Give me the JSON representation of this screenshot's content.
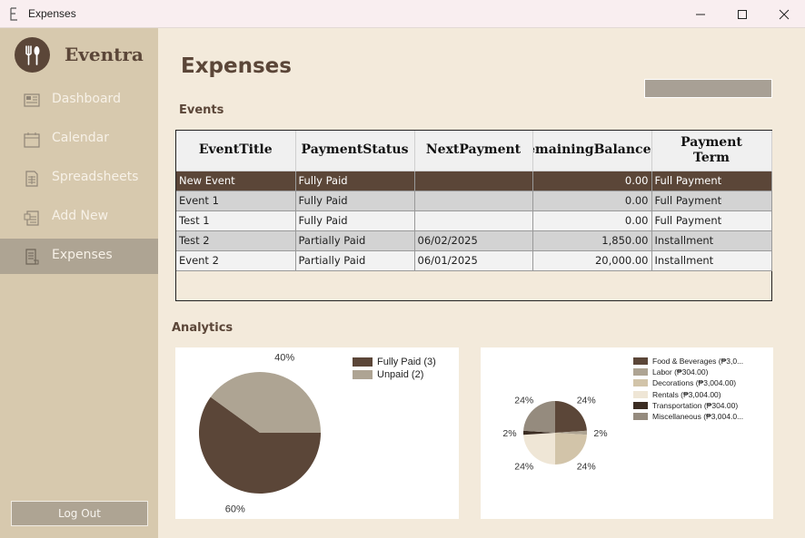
{
  "window": {
    "title": "Expenses"
  },
  "sidebar": {
    "brand": "Eventra",
    "items": [
      {
        "label": "Dashboard",
        "icon": "dashboard-icon",
        "active": false
      },
      {
        "label": "Calendar",
        "icon": "calendar-icon",
        "active": false
      },
      {
        "label": "Spreadsheets",
        "icon": "spreadsheet-icon",
        "active": false
      },
      {
        "label": "Add New",
        "icon": "add-new-icon",
        "active": false
      },
      {
        "label": "Expenses",
        "icon": "expenses-icon",
        "active": true
      }
    ],
    "logout_label": "Log Out"
  },
  "main": {
    "title": "Expenses",
    "events_label": "Events",
    "analytics_label": "Analytics",
    "table": {
      "headers": [
        "EventTitle",
        "PaymentStatus",
        "NextPayment",
        "RemainingBalance",
        "Payment\nTerm"
      ],
      "rows": [
        [
          "New Event",
          "Fully Paid",
          "",
          "0.00",
          "Full Payment"
        ],
        [
          "Event 1",
          "Fully Paid",
          "",
          "0.00",
          "Full Payment"
        ],
        [
          "Test 1",
          "Fully Paid",
          "",
          "0.00",
          "Full Payment"
        ],
        [
          "Test 2",
          "Partially Paid",
          "06/02/2025",
          "1,850.00",
          "Installment"
        ],
        [
          "Event 2",
          "Partially Paid",
          "06/01/2025",
          "20,000.00",
          "Installment"
        ]
      ]
    }
  },
  "colors": {
    "brand": "#5b4638",
    "sidebar_bg": "#d7c9ae",
    "active_bg": "#aea493",
    "page_bg": "#f3eadb"
  },
  "chart_data": [
    {
      "type": "pie",
      "series": [
        {
          "name": "Fully Paid (3)",
          "value": 60,
          "label": "60%",
          "color": "#5b4638"
        },
        {
          "name": "Unpaid (2)",
          "value": 40,
          "label": "40%",
          "color": "#aea493"
        }
      ]
    },
    {
      "type": "pie",
      "series": [
        {
          "name": "Food & Beverages (₱3,0...",
          "value": 24,
          "label": "24%",
          "color": "#5b4638"
        },
        {
          "name": "Labor (₱304.00)",
          "value": 2,
          "label": "2%",
          "color": "#aea493"
        },
        {
          "name": "Decorations (₱3,004.00)",
          "value": 24,
          "label": "24%",
          "color": "#d2c4a9"
        },
        {
          "name": "Rentals (₱3,004.00)",
          "value": 24,
          "label": "24%",
          "color": "#efe6d6"
        },
        {
          "name": "Transportation (₱304.00)",
          "value": 2,
          "label": "2%",
          "color": "#3b2c22"
        },
        {
          "name": "Miscellaneous (₱3,004.0...",
          "value": 24,
          "label": "24%",
          "color": "#958b7e"
        }
      ]
    }
  ]
}
